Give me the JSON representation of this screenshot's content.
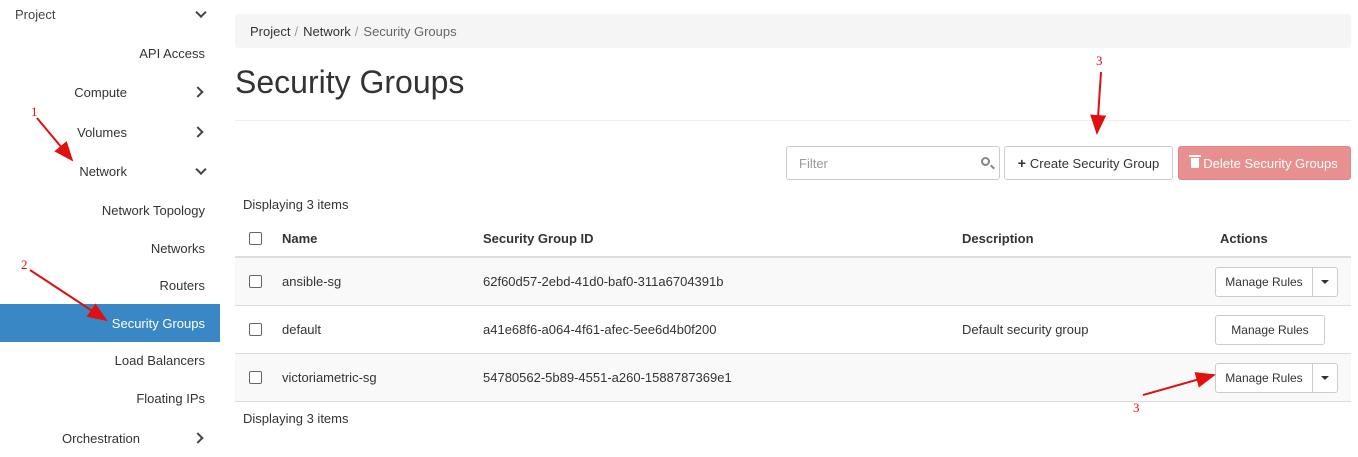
{
  "sidebar": {
    "project": "Project",
    "items": [
      {
        "label": "API Access"
      },
      {
        "label": "Compute"
      },
      {
        "label": "Volumes"
      },
      {
        "label": "Network"
      },
      {
        "label": "Network Topology"
      },
      {
        "label": "Networks"
      },
      {
        "label": "Routers"
      },
      {
        "label": "Security Groups"
      },
      {
        "label": "Load Balancers"
      },
      {
        "label": "Floating IPs"
      },
      {
        "label": "Orchestration"
      }
    ]
  },
  "breadcrumb": [
    "Project",
    "Network",
    "Security Groups"
  ],
  "page_title": "Security Groups",
  "toolbar": {
    "filter_placeholder": "Filter",
    "create_label": "Create Security Group",
    "delete_label": "Delete Security Groups"
  },
  "display_count": "Displaying 3 items",
  "table": {
    "headers": [
      "Name",
      "Security Group ID",
      "Description",
      "Actions"
    ],
    "rows": [
      {
        "name": "ansible-sg",
        "id": "62f60d57-2ebd-41d0-baf0-311a6704391b",
        "description": "",
        "action": "Manage Rules"
      },
      {
        "name": "default",
        "id": "a41e68f6-a064-4f61-afec-5ee6d4b0f200",
        "description": "Default security group",
        "action": "Manage Rules"
      },
      {
        "name": "victoriametric-sg",
        "id": "54780562-5b89-4551-a260-1588787369e1",
        "description": "",
        "action": "Manage Rules"
      }
    ]
  },
  "annotations": {
    "color": "#e01010",
    "labels": [
      "1",
      "2",
      "3",
      "3"
    ]
  },
  "colors": {
    "active": "#3a87c6",
    "danger": "#e89090"
  }
}
